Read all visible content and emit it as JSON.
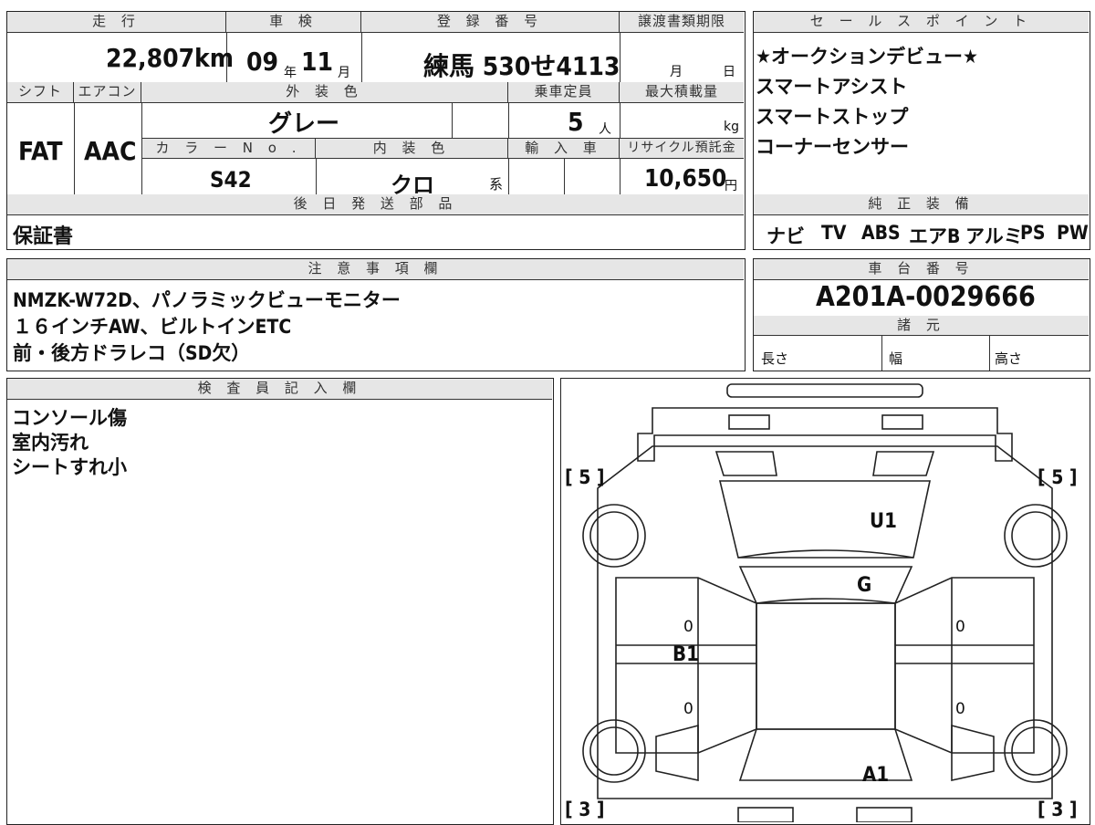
{
  "headers": {
    "mileage": "走 行",
    "inspection": "車 検",
    "registration": "登 録 番 号",
    "transfer_deadline": "譲渡書類期限",
    "sales_points": "セ ー ル ス ポ イ ン ト",
    "shift": "シフト",
    "aircon": "エアコン",
    "exterior_color": "外 装 色",
    "capacity": "乗車定員",
    "max_load": "最大積載量",
    "color_no": "カ ラ ー N o .",
    "interior_color": "内 装 色",
    "import": "輸 入 車",
    "recycle": "リサイクル預託金",
    "later_parts": "後 日 発 送 部 品",
    "genuine_equipment": "純 正 装 備",
    "notes": "注 意 事 項 欄",
    "chassis_no": "車 台 番 号",
    "specs": "諸 元",
    "inspector": "検 査 員 記 入 欄"
  },
  "values": {
    "mileage": "22,807",
    "mileage_unit": "km",
    "inspection_year": "09",
    "year_unit": "年",
    "inspection_month": "11",
    "month_unit": "月",
    "plate": "練馬 530せ4113",
    "deadline_month": "月",
    "deadline_day": "日",
    "shift": "FAT",
    "aircon": "AAC",
    "exterior_color": "グレー",
    "capacity": "5",
    "capacity_unit": "人",
    "load_unit": "kg",
    "color_no": "S42",
    "interior_color": "クロ",
    "interior_suffix": "系",
    "recycle": "10,650",
    "recycle_unit": "円",
    "later_parts": "保証書",
    "chassis_no": "A201A-0029666",
    "length": "長さ",
    "width": "幅",
    "height": "高さ"
  },
  "sales_points": [
    "★オークションデビュー★",
    "スマートアシスト",
    "スマートストップ",
    "コーナーセンサー"
  ],
  "equipment": [
    "ナビ",
    "TV",
    "ABS",
    "エアB",
    "アルミ",
    "PS",
    "PW"
  ],
  "notes": [
    "NMZK-W72D、パノラミックビューモニター",
    "１６インチAW、ビルトインETC",
    "前・後方ドラレコ（SD欠）"
  ],
  "inspector_notes": [
    "コンソール傷",
    "室内汚れ",
    "シートすれ小"
  ],
  "diagram": {
    "tire_front_left": "[ 5 ]",
    "tire_front_right": "[ 5 ]",
    "tire_rear_left": "[ 3 ]",
    "tire_rear_right": "[ 3 ]",
    "mark_roof": "U1",
    "mark_glass": "G",
    "mark_side": "B1",
    "mark_rear": "A1",
    "door_zero_1": "0",
    "door_zero_2": "0",
    "door_zero_3": "0",
    "door_zero_4": "0"
  }
}
